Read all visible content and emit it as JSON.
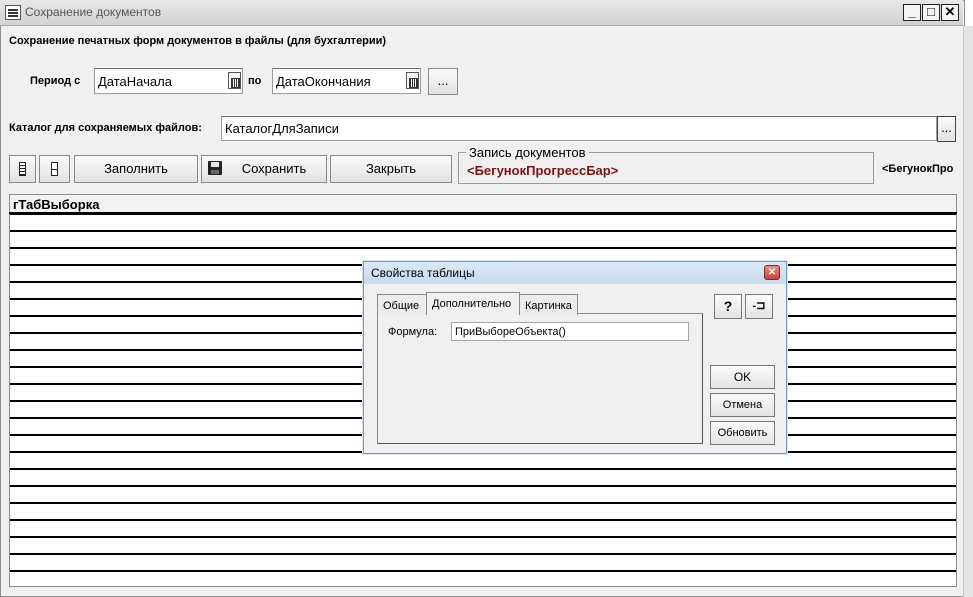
{
  "window": {
    "title": "Сохранение документов",
    "controls": [
      "_",
      "□",
      "✕"
    ]
  },
  "form": {
    "heading": "Сохранение печатных форм документов в файлы (для бухгалтерии)",
    "period_label": "Период с",
    "period_from": "ДатаНачала",
    "period_to_label": "по",
    "period_to": "ДатаОкончания",
    "period_select_label": "...",
    "catalog_label": "Каталог для сохраняемых файлов:",
    "catalog_value": "КаталогДляЗаписи",
    "catalog_select_label": "..."
  },
  "toolbar": {
    "fill_label": "Заполнить",
    "save_label": "Сохранить",
    "close_label": "Закрыть"
  },
  "progress_group": {
    "title": "Запись документов",
    "progress_text": "<БегунокПрогрессБар>",
    "side_text": "<БегунокПро"
  },
  "table": {
    "header": "гТабВыборка"
  },
  "dialog": {
    "title": "Свойства таблицы",
    "tabs": [
      {
        "label": "Общие",
        "active": false
      },
      {
        "label": "Дополнительно",
        "active": true
      },
      {
        "label": "Картинка",
        "active": false
      }
    ],
    "formula_label": "Формула:",
    "formula_value": "ПриВыбореОбъекта()",
    "help_icon_glyph": "?",
    "pin_icon_glyph": "-⊐",
    "ok_label": "OK",
    "cancel_label": "Отмена",
    "refresh_label": "Обновить"
  },
  "icons": [
    "window-form-icon",
    "calendar-icon",
    "save-disk-icon",
    "help-icon",
    "pin-icon",
    "close-icon"
  ]
}
